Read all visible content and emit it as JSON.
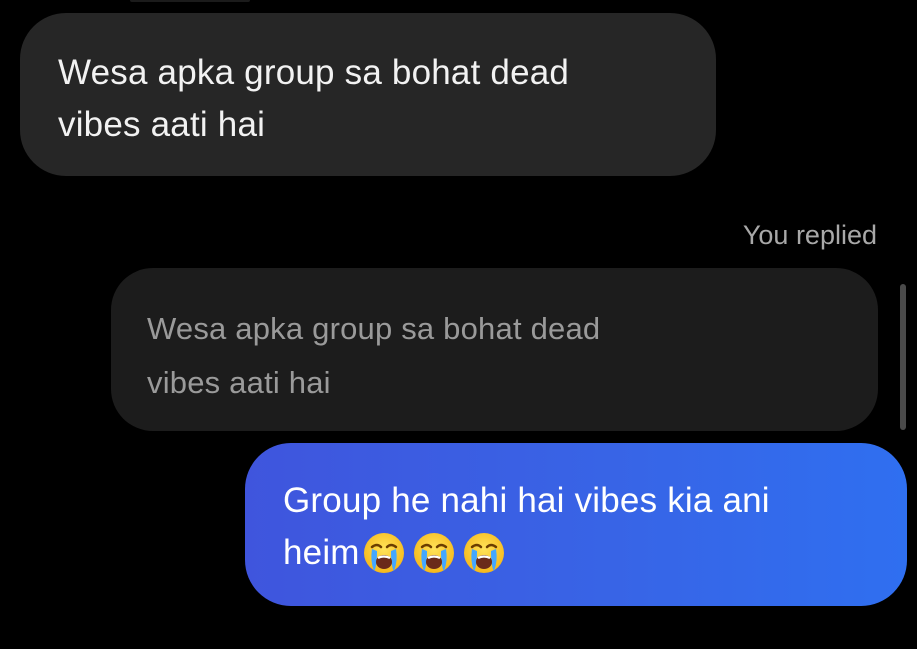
{
  "messages": {
    "incoming": {
      "text": "Wesa apka group sa bohat dead\nvibes aati hai"
    },
    "reply_caption": "You replied",
    "quoted": {
      "text": "Wesa apka group sa bohat dead\nvibes aati hai"
    },
    "outgoing": {
      "line1": "Group he nahi hai vibes kia ani",
      "line2": "heim",
      "emojis": [
        "loudly-crying-face-emoji",
        "loudly-crying-face-emoji",
        "loudly-crying-face-emoji"
      ]
    }
  },
  "colors": {
    "background": "#000000",
    "incoming_bubble": "#262626",
    "quoted_bubble": "#1c1c1c",
    "outgoing_gradient_start": "#3f55dd",
    "outgoing_gradient_end": "#2f6ff0",
    "caption_text": "#a8a8a8"
  }
}
